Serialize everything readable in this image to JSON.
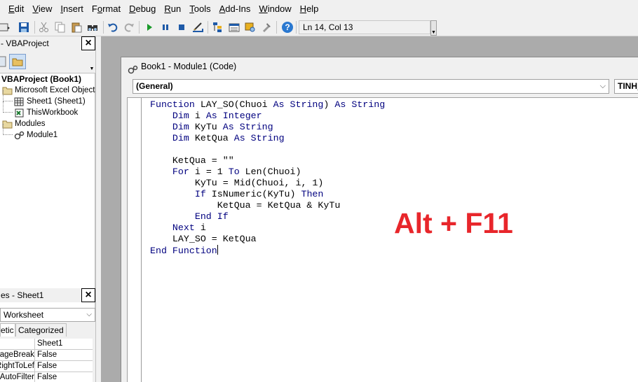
{
  "menu": [
    {
      "ul": "E",
      "rest": "dit"
    },
    {
      "ul": "V",
      "rest": "iew"
    },
    {
      "ul": "I",
      "rest": "nsert"
    },
    {
      "pre": "F",
      "ul": "o",
      "rest": "rmat"
    },
    {
      "ul": "D",
      "rest": "ebug"
    },
    {
      "ul": "R",
      "rest": "un"
    },
    {
      "ul": "T",
      "rest": "ools"
    },
    {
      "ul": "A",
      "rest": "dd-Ins"
    },
    {
      "ul": "W",
      "rest": "indow"
    },
    {
      "ul": "H",
      "rest": "elp"
    }
  ],
  "toolbar": {
    "cursor_position": "Ln 14, Col 13"
  },
  "project_panel": {
    "title": "- VBAProject",
    "tree": {
      "root": "VBAProject (Book1)",
      "excel_objects": "Microsoft Excel Objects",
      "sheet1": "Sheet1 (Sheet1)",
      "workbook": "ThisWorkbook",
      "modules": "Modules",
      "module1": "Module1"
    }
  },
  "properties_panel": {
    "title": "es - Sheet1",
    "object_select": "Worksheet",
    "tabs": {
      "alphabetic": "etic",
      "categorized": "Categorized"
    },
    "rows": [
      {
        "name": "",
        "value": "Sheet1"
      },
      {
        "name": "PageBreak",
        "value": "False"
      },
      {
        "name": "RightToLef",
        "value": "False"
      },
      {
        "name": "AutoFilter",
        "value": "False"
      }
    ]
  },
  "code_window": {
    "title": "Book1 - Module1 (Code)",
    "object_combo": "(General)",
    "procedure_combo": "TINH_"
  },
  "code": {
    "l1": [
      "Function",
      " LAY_SO(Chuoi ",
      "As",
      " ",
      "String",
      ") ",
      "As",
      " ",
      "String"
    ],
    "l2": [
      "    ",
      "Dim",
      " i ",
      "As",
      " ",
      "Integer"
    ],
    "l3": [
      "    ",
      "Dim",
      " KyTu ",
      "As",
      " ",
      "String"
    ],
    "l4": [
      "    ",
      "Dim",
      " KetQua ",
      "As",
      " ",
      "String"
    ],
    "l6": [
      "    KetQua = \"\""
    ],
    "l7": [
      "    ",
      "For",
      " i = 1 ",
      "To",
      " Len(Chuoi)"
    ],
    "l8": [
      "        KyTu = Mid(Chuoi, i, 1)"
    ],
    "l9": [
      "        ",
      "If",
      " IsNumeric(KyTu) ",
      "Then"
    ],
    "l10": [
      "            KetQua = KetQua & KyTu"
    ],
    "l11": [
      "        ",
      "End If"
    ],
    "l12": [
      "    ",
      "Next",
      " i"
    ],
    "l13": [
      "    LAY_SO = KetQua"
    ],
    "l14": [
      "End Function"
    ]
  },
  "overlay": "Alt + F11",
  "colors": {
    "keyword": "#00007f",
    "overlay": "#e8262b",
    "mdi_background": "#ababab"
  }
}
